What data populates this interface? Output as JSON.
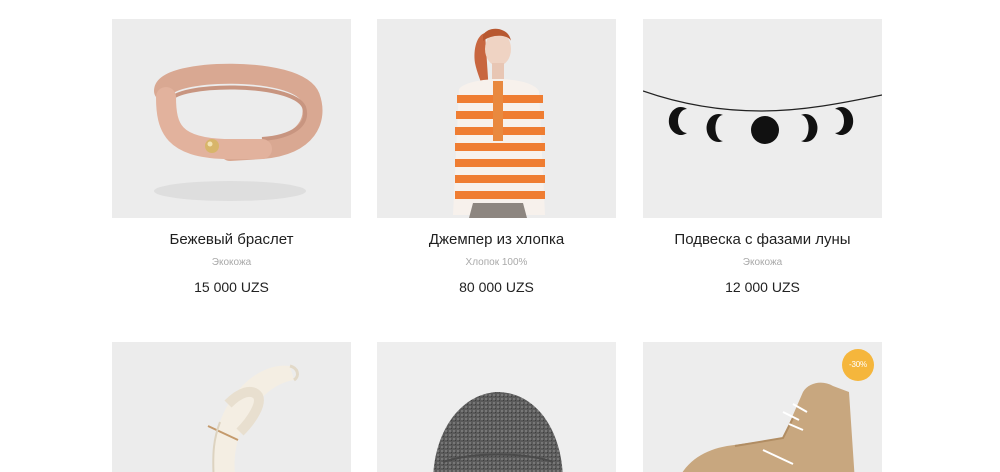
{
  "products": [
    {
      "name": "Бежевый браслет",
      "material": "Экокожа",
      "price": "15 000 UZS",
      "image": "beige-leather-bracelet"
    },
    {
      "name": "Джемпер из хлопка",
      "material": "Хлопок 100%",
      "price": "80 000 UZS",
      "image": "striped-cotton-jumper"
    },
    {
      "name": "Подвеска с фазами луны",
      "material": "Экокожа",
      "price": "12 000 UZS",
      "image": "moon-phases-garland"
    },
    {
      "image": "ivory-leather-strap"
    },
    {
      "image": "grey-knit-beanie"
    },
    {
      "image": "beige-high-top-sneaker",
      "badge": "-30%"
    }
  ],
  "colors": {
    "badge": "#f5b63c",
    "material_text": "#a9a9a9"
  }
}
